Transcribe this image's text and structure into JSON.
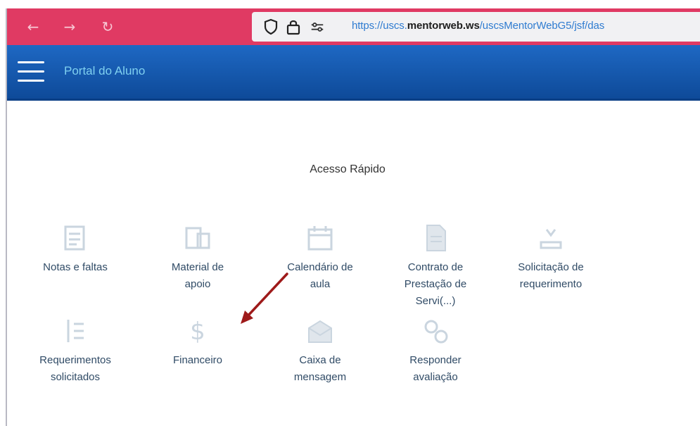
{
  "browser": {
    "url_prefix": "https://uscs.",
    "url_domain": "mentorweb.ws",
    "url_suffix": "/uscsMentorWebG5/jsf/das",
    "back_icon": "arrow-left-icon",
    "forward_icon": "arrow-right-icon",
    "reload_icon": "reload-icon",
    "shield_icon": "shield-icon",
    "lock_icon": "lock-icon",
    "permissions_icon": "sliders-icon"
  },
  "header": {
    "title": "Portal do Aluno",
    "menu_icon": "hamburger-menu-icon"
  },
  "main": {
    "quick_access_title": "Acesso Rápido",
    "tiles": [
      {
        "label": "Notas e faltas",
        "icon": "grades-icon"
      },
      {
        "label": "Material de\napoio",
        "icon": "materials-icon"
      },
      {
        "label": "Calendário de\naula",
        "icon": "calendar-icon"
      },
      {
        "label": "Contrato de\nPrestação de\nServi(...)",
        "icon": "contract-icon"
      },
      {
        "label": "Solicitação de\nrequerimento",
        "icon": "request-icon"
      },
      {
        "label": "Requerimentos\nsolicitados",
        "icon": "list-icon"
      },
      {
        "label": "Financeiro",
        "icon": "dollar-icon"
      },
      {
        "label": "Caixa de\nmensagem",
        "icon": "inbox-icon"
      },
      {
        "label": "Responder\navaliação",
        "icon": "evaluation-icon"
      }
    ]
  },
  "colors": {
    "browser_bar": "#e03a63",
    "header": "#1e68c3",
    "title_text": "#7fd0f0",
    "tile_text": "#304b66",
    "annotation_arrow": "#9e1a1a"
  }
}
